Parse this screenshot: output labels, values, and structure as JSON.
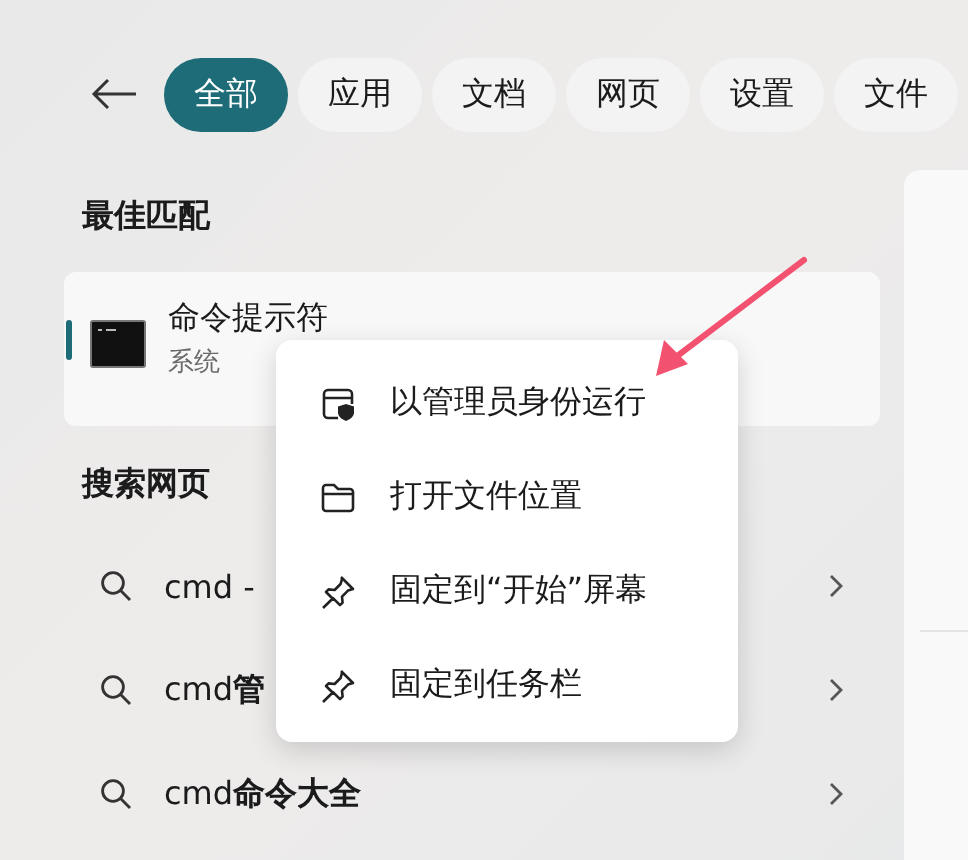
{
  "tabs": [
    {
      "label": "全部",
      "selected": true
    },
    {
      "label": "应用",
      "selected": false
    },
    {
      "label": "文档",
      "selected": false
    },
    {
      "label": "网页",
      "selected": false
    },
    {
      "label": "设置",
      "selected": false
    },
    {
      "label": "文件",
      "selected": false
    }
  ],
  "best_match": {
    "heading": "最佳匹配",
    "item": {
      "title": "命令提示符",
      "subtitle": "系统",
      "selected": true
    }
  },
  "web_search": {
    "heading": "搜索网页",
    "results": [
      {
        "text": "cmd -"
      },
      {
        "text": "cmd**管**"
      },
      {
        "text": "cmd**命令大全**"
      }
    ]
  },
  "context_menu": {
    "items": [
      {
        "label": "以管理员身份运行",
        "kind": "admin"
      },
      {
        "label": "打开文件位置",
        "kind": "folder"
      },
      {
        "label": "固定到“开始”屏幕",
        "kind": "pin"
      },
      {
        "label": "固定到任务栏",
        "kind": "pin"
      }
    ]
  }
}
